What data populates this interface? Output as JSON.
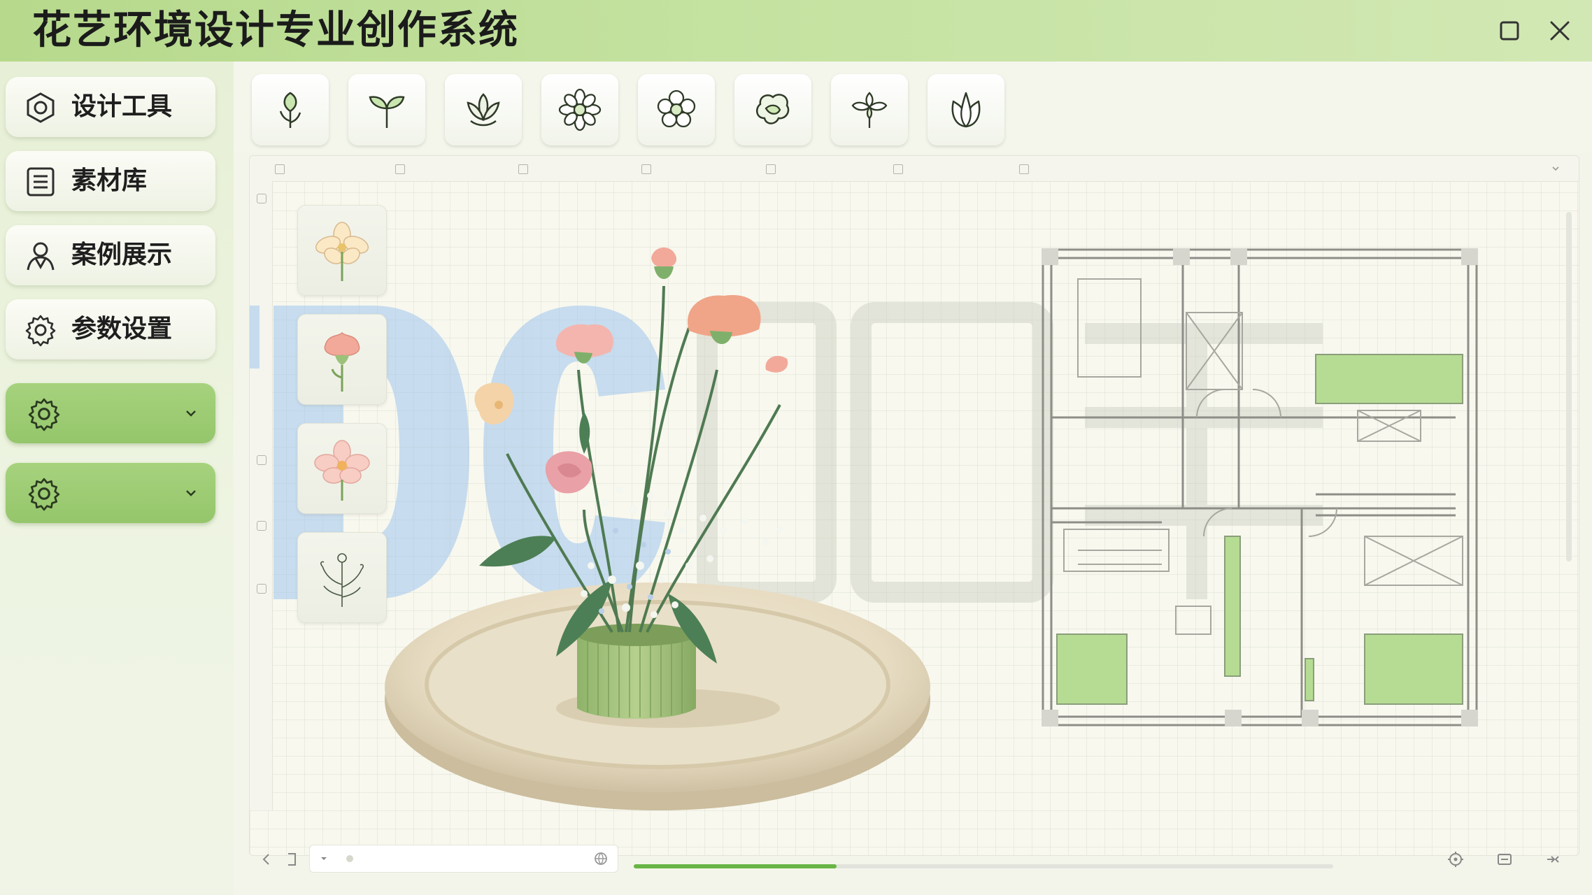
{
  "window": {
    "title": "花艺环境设计专业创作系统",
    "controls": [
      "maximize-icon",
      "close-icon"
    ]
  },
  "sidebar": {
    "items": [
      {
        "label": "设计工具",
        "icon": "hexagon-icon"
      },
      {
        "label": "素材库",
        "icon": "document-list-icon"
      },
      {
        "label": "案例展示",
        "icon": "user-case-icon"
      },
      {
        "label": "参数设置",
        "icon": "gear-icon"
      }
    ],
    "expandables": [
      {
        "icon": "gear-icon",
        "chevron": "chevron-down-icon"
      },
      {
        "icon": "gear-icon",
        "chevron": "chevron-down-icon"
      }
    ],
    "colors": {
      "active_green": "#9ccb72",
      "panel": "#eaf1dc"
    }
  },
  "toolbar": {
    "tools": [
      "tulip-bud-icon",
      "leafy-sprout-icon",
      "lotus-icon",
      "daisy-icon",
      "five-petal-flower-icon",
      "peony-icon",
      "orchid-icon",
      "tulip-icon"
    ]
  },
  "materials": [
    {
      "name": "pale-yellow-flower-icon"
    },
    {
      "name": "pink-carnation-icon"
    },
    {
      "name": "pink-blossom-icon"
    },
    {
      "name": "sketched-flower-stems-icon"
    }
  ],
  "canvas": {
    "objects": [
      "flower-arrangement-render",
      "floor-plan-drawing"
    ]
  },
  "statusbar": {
    "progress_fraction": 0.29,
    "controls": [
      "chevron-left-icon",
      "page-icon",
      "dropdown-icon",
      "globe-icon",
      "target-icon",
      "minimize-panel-icon",
      "collapse-icon"
    ]
  },
  "theme": {
    "title_bar": "#bcdc95",
    "accent": "#68b545",
    "plan_fill": "#b6dc93"
  }
}
